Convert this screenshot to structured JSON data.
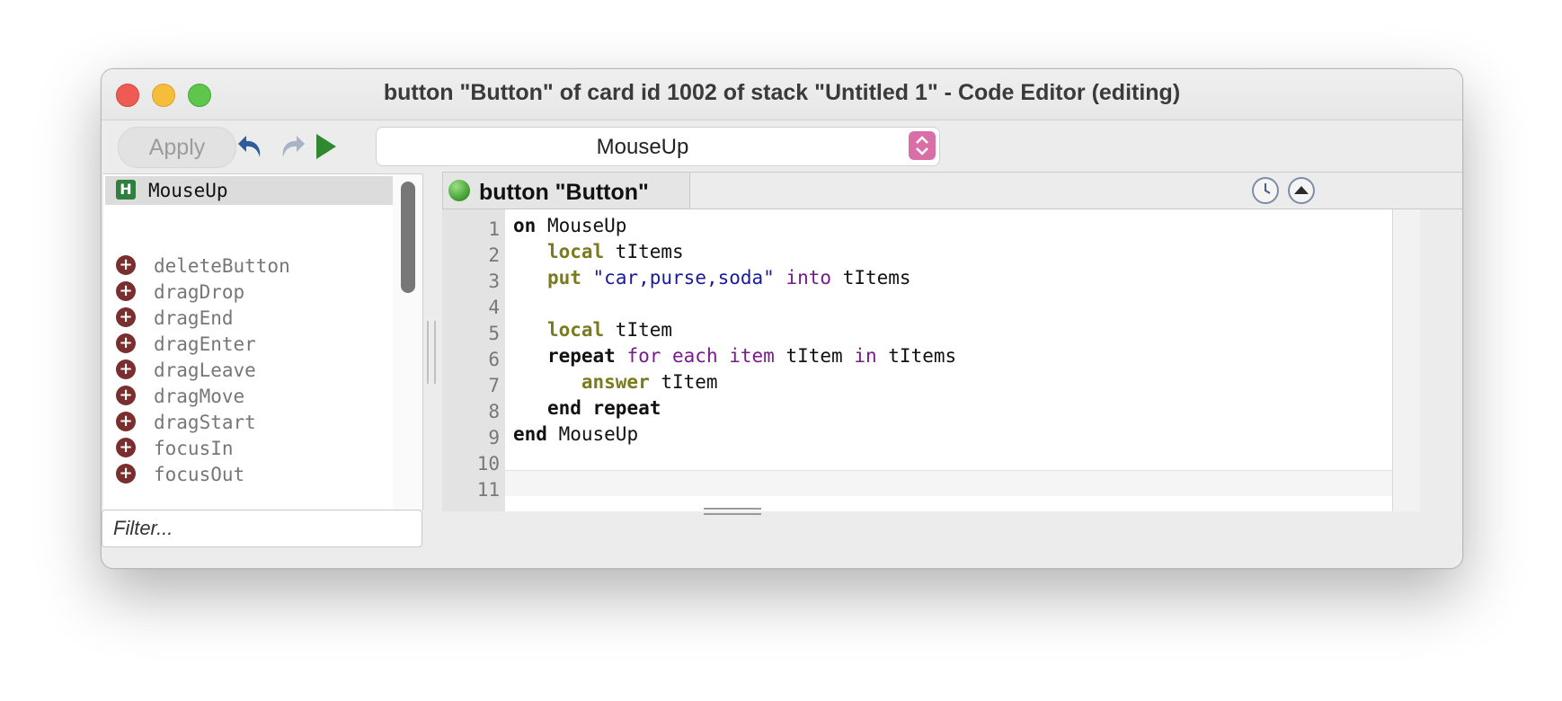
{
  "window": {
    "title": "button \"Button\" of card id 1002 of stack \"Untitled 1\" - Code Editor (editing)"
  },
  "toolbar": {
    "apply_label": "Apply",
    "undo_icon": "undo-icon",
    "redo_icon": "redo-icon",
    "run_icon": "play-icon",
    "handler_select_value": "MouseUp"
  },
  "sidebar": {
    "current_handler": {
      "badge": "H",
      "label": "MouseUp"
    },
    "messages": [
      {
        "label": "deleteButton"
      },
      {
        "label": "dragDrop"
      },
      {
        "label": "dragEnd"
      },
      {
        "label": "dragEnter"
      },
      {
        "label": "dragLeave"
      },
      {
        "label": "dragMove"
      },
      {
        "label": "dragStart"
      },
      {
        "label": "focusIn"
      },
      {
        "label": "focusOut"
      }
    ],
    "filter_placeholder": "Filter..."
  },
  "script_tab": {
    "label": "button \"Button\""
  },
  "editor": {
    "line_numbers": [
      "1",
      "2",
      "3",
      "4",
      "5",
      "6",
      "7",
      "8",
      "9",
      "10",
      "11"
    ],
    "lines": [
      {
        "indent": "",
        "tokens": [
          [
            "kw-b",
            "on"
          ],
          [
            "plain",
            " MouseUp"
          ]
        ]
      },
      {
        "indent": "   ",
        "tokens": [
          [
            "kw-o",
            "local"
          ],
          [
            "plain",
            " tItems"
          ]
        ]
      },
      {
        "indent": "   ",
        "tokens": [
          [
            "kw-o",
            "put"
          ],
          [
            "plain",
            " "
          ],
          [
            "str",
            "\"car,purse,soda\""
          ],
          [
            "plain",
            " "
          ],
          [
            "kw-p",
            "into"
          ],
          [
            "plain",
            " tItems"
          ]
        ]
      },
      {
        "indent": "",
        "tokens": []
      },
      {
        "indent": "   ",
        "tokens": [
          [
            "kw-o",
            "local"
          ],
          [
            "plain",
            " tItem"
          ]
        ]
      },
      {
        "indent": "   ",
        "tokens": [
          [
            "kw-b",
            "repeat"
          ],
          [
            "plain",
            " "
          ],
          [
            "kw-p",
            "for each item"
          ],
          [
            "plain",
            " tItem "
          ],
          [
            "kw-p",
            "in"
          ],
          [
            "plain",
            " tItems"
          ]
        ]
      },
      {
        "indent": "      ",
        "tokens": [
          [
            "kw-o",
            "answer"
          ],
          [
            "plain",
            " tItem"
          ]
        ]
      },
      {
        "indent": "   ",
        "tokens": [
          [
            "kw-b",
            "end repeat"
          ]
        ]
      },
      {
        "indent": "",
        "tokens": [
          [
            "kw-b",
            "end"
          ],
          [
            "plain",
            " MouseUp"
          ]
        ]
      },
      {
        "indent": "",
        "tokens": []
      }
    ]
  },
  "colors": {
    "handler_badge": "#2f7f3f",
    "message_plus": "#7a2e2e",
    "stepper": "#d96fa6",
    "keyword_olive": "#7a7a1e",
    "keyword_purple": "#7a1a8c",
    "string_blue": "#1a1a9e"
  }
}
